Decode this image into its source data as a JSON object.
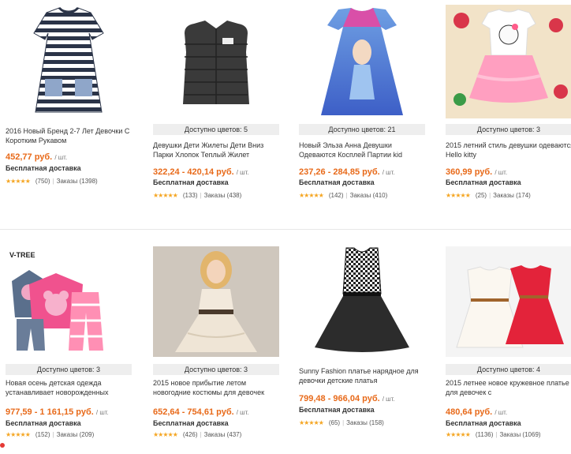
{
  "rows": [
    [
      {
        "colors": "",
        "title": "2016 Новый Бренд 2-7 Лет Девочки С Коротким Рукавом",
        "price": "452,77 руб.",
        "unit": "/ шт.",
        "shipping": "Бесплатная доставка",
        "stars": "★★★★★",
        "reviews": "(750)",
        "orders": "Заказы (1398)"
      },
      {
        "colors": "Доступно цветов: 5",
        "title": "Девушки Дети Жилеты Дети Вниз Парки Хлопок Теплый Жилет",
        "price": "322,24 - 420,14 руб.",
        "unit": "/ шт.",
        "shipping": "Бесплатная доставка",
        "stars": "★★★★★",
        "reviews": "(133)",
        "orders": "Заказы (438)"
      },
      {
        "colors": "Доступно цветов: 21",
        "title": "Новый Эльза Анна Девушки Одеваются Косплей Партии kid",
        "price": "237,26 - 284,85 руб.",
        "unit": "/ шт.",
        "shipping": "Бесплатная доставка",
        "stars": "★★★★★",
        "reviews": "(142)",
        "orders": "Заказы (410)"
      },
      {
        "colors": "Доступно цветов: 3",
        "title": "2015 летний стиль девушки одеваются Hello kitty",
        "price": "360,99 руб.",
        "unit": "/ шт.",
        "shipping": "Бесплатная доставка",
        "stars": "★★★★★",
        "reviews": "(25)",
        "orders": "Заказы (174)"
      }
    ],
    [
      {
        "colors": "Доступно цветов: 3",
        "title": "Новая осень детская одежда устанавливает новорожденных",
        "price": "977,59 - 1 161,15 руб.",
        "unit": "/ шт.",
        "shipping": "Бесплатная доставка",
        "stars": "★★★★★",
        "reviews": "(152)",
        "orders": "Заказы (209)",
        "logo": "V-TREE"
      },
      {
        "colors": "Доступно цветов: 3",
        "title": "2015 новое прибытие летом новогодние костюмы для девочек",
        "price": "652,64 - 754,61 руб.",
        "unit": "/ шт.",
        "shipping": "Бесплатная доставка",
        "stars": "★★★★★",
        "reviews": "(426)",
        "orders": "Заказы (437)"
      },
      {
        "colors": "",
        "title": "Sunny Fashion платье нарядное для девочки детские платья",
        "price": "799,48 - 966,04 руб.",
        "unit": "/ шт.",
        "shipping": "Бесплатная доставка",
        "stars": "★★★★★",
        "reviews": "(65)",
        "orders": "Заказы (158)"
      },
      {
        "colors": "Доступно цветов: 4",
        "title": "2015 летнее новое кружевное платье для девочек с",
        "price": "480,64 руб.",
        "unit": "/ шт.",
        "shipping": "Бесплатная доставка",
        "stars": "★★★★★",
        "reviews": "(1136)",
        "orders": "Заказы (1069)"
      }
    ]
  ],
  "colors": {
    "price": "#e86a1a",
    "stars": "#f5a623",
    "colors_bar": "#eeeeee"
  }
}
